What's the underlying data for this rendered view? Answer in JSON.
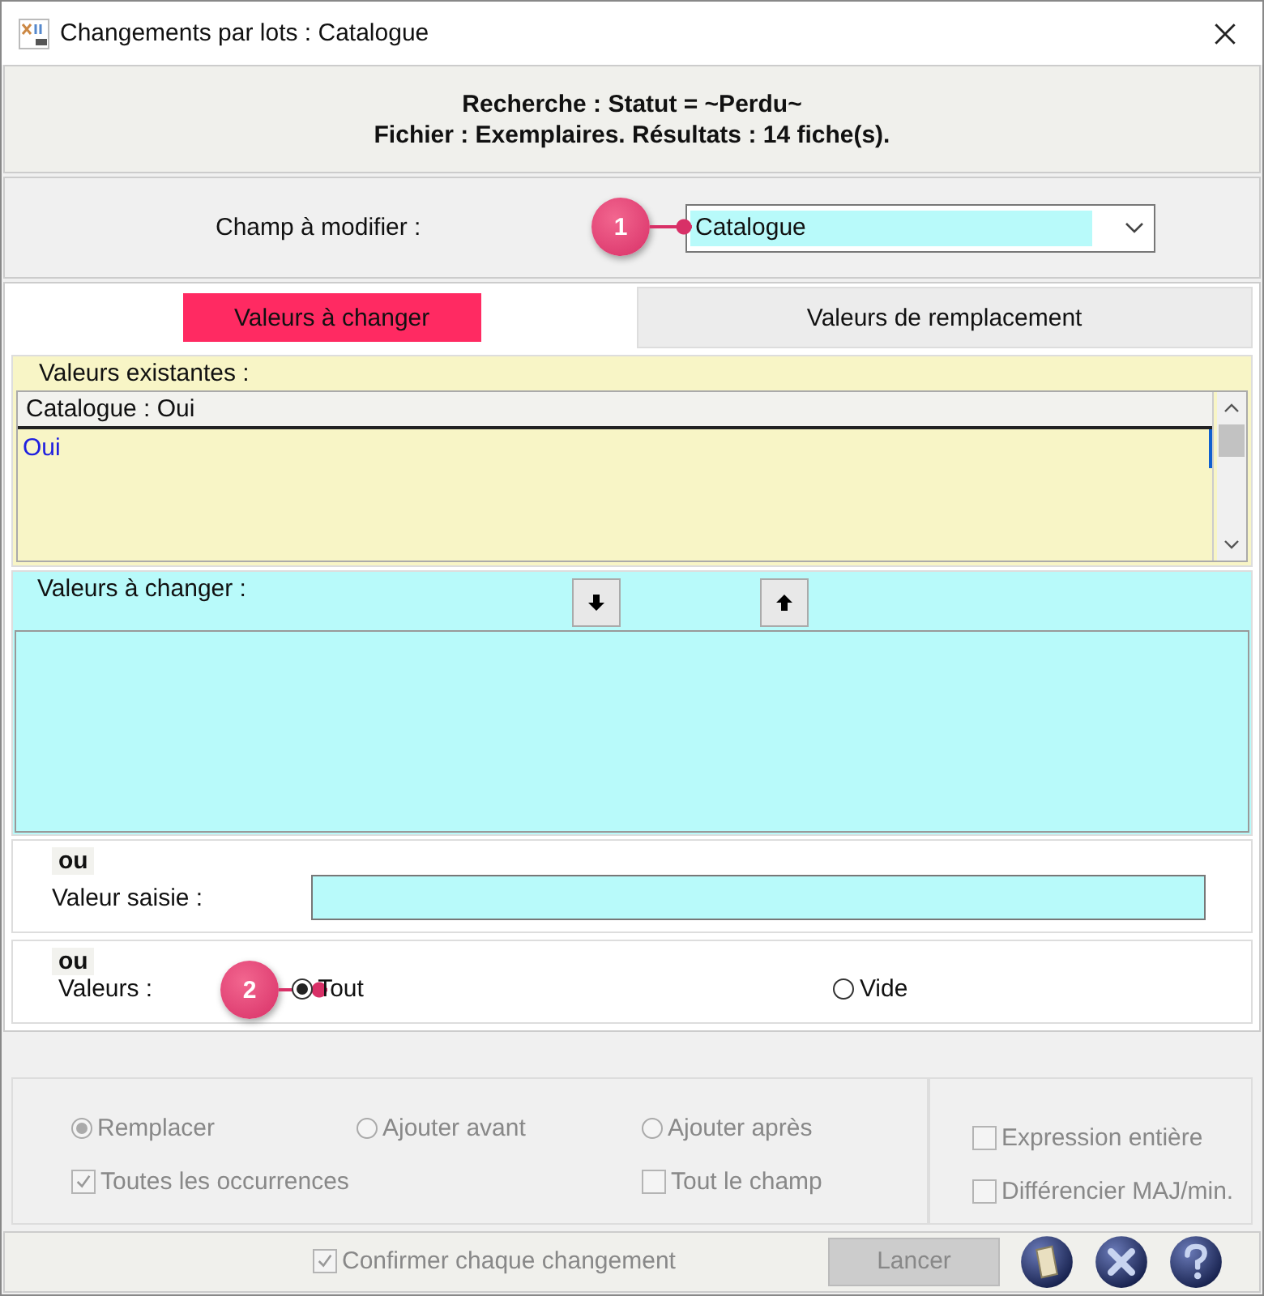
{
  "window": {
    "title": "Changements par lots : Catalogue"
  },
  "search_summary": [
    "Recherche : Statut = ~Perdu~",
    "Fichier : Exemplaires. Résultats : 14 fiche(s)."
  ],
  "field_to_modify": {
    "label": "Champ à modifier :",
    "value": "Catalogue",
    "callout": "1"
  },
  "tabs": [
    {
      "label": "Valeurs à changer",
      "selected": true
    },
    {
      "label": "Valeurs de remplacement",
      "selected": false
    }
  ],
  "existing_values": {
    "label": "Valeurs existantes :",
    "column": "Catalogue  : Oui",
    "rows": [
      {
        "text": "Oui",
        "selected": true
      }
    ]
  },
  "values_to_change": {
    "label": "Valeurs à changer :"
  },
  "typed_value": {
    "or": "ou",
    "label": "Valeur saisie :"
  },
  "values": {
    "or": "ou",
    "label": "Valeurs :",
    "callout": "2",
    "options": [
      {
        "label": "Tout",
        "selected": true
      },
      {
        "label": "Vide",
        "selected": false
      }
    ]
  },
  "mode_options": [
    {
      "label": "Remplacer",
      "selected": true,
      "disabled": true
    },
    {
      "label": "Ajouter avant",
      "selected": false,
      "disabled": true
    },
    {
      "label": "Ajouter après",
      "selected": false,
      "disabled": true
    }
  ],
  "scope_options": [
    {
      "label": "Toutes les occurrences",
      "checked": true,
      "disabled": true
    },
    {
      "label": "Tout le champ",
      "checked": false,
      "disabled": true
    }
  ],
  "match_options": [
    {
      "label": "Expression entière",
      "checked": false,
      "disabled": true
    },
    {
      "label": "Différencier MAJ/min.",
      "checked": false,
      "disabled": true
    }
  ],
  "confirm": {
    "label": "Confirmer chaque changement",
    "checked": true,
    "disabled": true
  },
  "launch_button": {
    "label": "Lancer",
    "disabled": true
  }
}
